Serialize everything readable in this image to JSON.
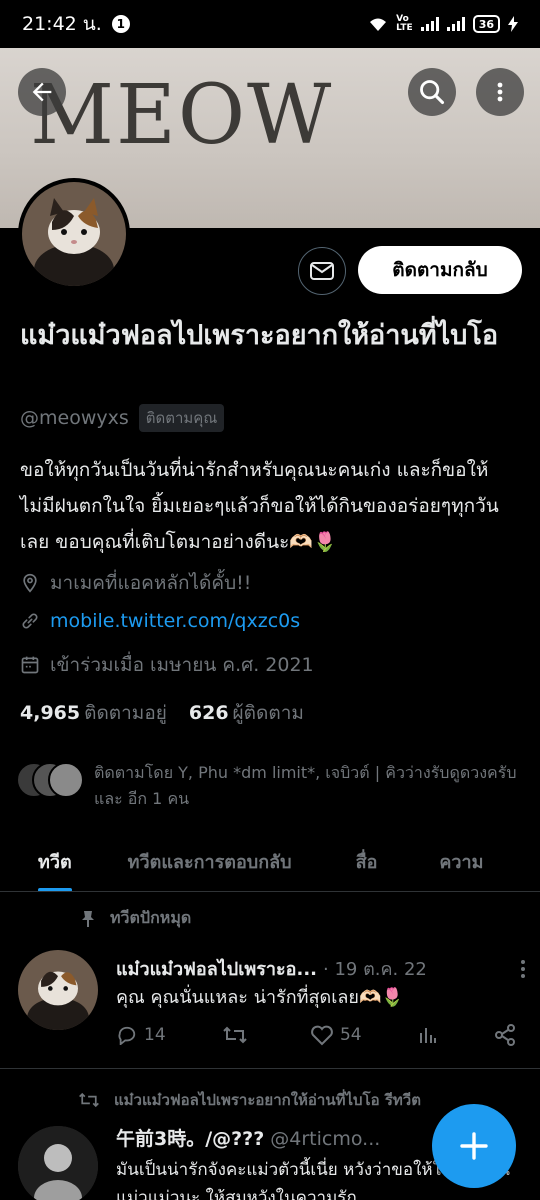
{
  "status_bar": {
    "time": "21:42 น.",
    "notification_count": "1",
    "battery": "36"
  },
  "banner": {
    "text": "MEOW"
  },
  "profile": {
    "display_name": "แม๋วแม๋วฟอลไปเพราะอยากให้อ่านที่ไบโอ",
    "handle": "@meowyxs",
    "follows_you_badge": "ติดตามคุณ",
    "follow_back_label": "ติดตามกลับ",
    "bio": "ขอให้ทุกวันเป็นวันที่น่ารักสำหรับคุณนะคนเก่ง และก็ขอให้ไม่มีฝนตกในใจ ยิ้มเยอะๆแล้วก็ขอให้ได้กินของอร่อยๆทุกวันเลย ขอบคุณที่เติบโตมาอย่างดีนะ🫶🏻🌷",
    "location": "มาเมคที่แอคหลักได้คั้บ!!",
    "link": "mobile.twitter.com/qxzc0s",
    "joined": "เข้าร่วมเมื่อ เมษายน ค.ศ. 2021",
    "following_count": "4,965",
    "following_label": "ติดตามอยู่",
    "followers_count": "626",
    "followers_label": "ผู้ติดตาม",
    "followed_by": "ติดตามโดย Y, Phu *dm limit*, เจบิวต์ | คิวว่างรับดูดวงครับ และ อีก 1 คน"
  },
  "tabs": [
    {
      "label": "ทวีต"
    },
    {
      "label": "ทวีตและการตอบกลับ"
    },
    {
      "label": "สื่อ"
    },
    {
      "label": "ความ"
    }
  ],
  "pinned_tweet": {
    "pinned_label": "ทวีตปักหมุด",
    "author": "แม๋วแม๋วฟอลไปเพราะอ...",
    "date": "· 19 ต.ค. 22",
    "text": "คุณ คุณนั่นแหละ น่ารักที่สุดเลย🫶🏻🌷",
    "replies": "14",
    "retweets": "",
    "likes": "54"
  },
  "retweet": {
    "retweet_label": "แม๋วแม๋วฟอลไปเพราะอยากให้อ่านที่ไบโอ รีทวีต",
    "author": "午前3時。/@???",
    "handle": "@4rticmo...",
    "text": "มันเป็นน่ารักจังคะแม่วตัวนี้เนี่ย หวังว่าขอให้ใจดีกับคุณแม่วแม่วนะ ให้สมหวังในความรัก"
  },
  "colors": {
    "accent": "#1d9bf0",
    "background": "#000000",
    "muted": "#71767b"
  }
}
